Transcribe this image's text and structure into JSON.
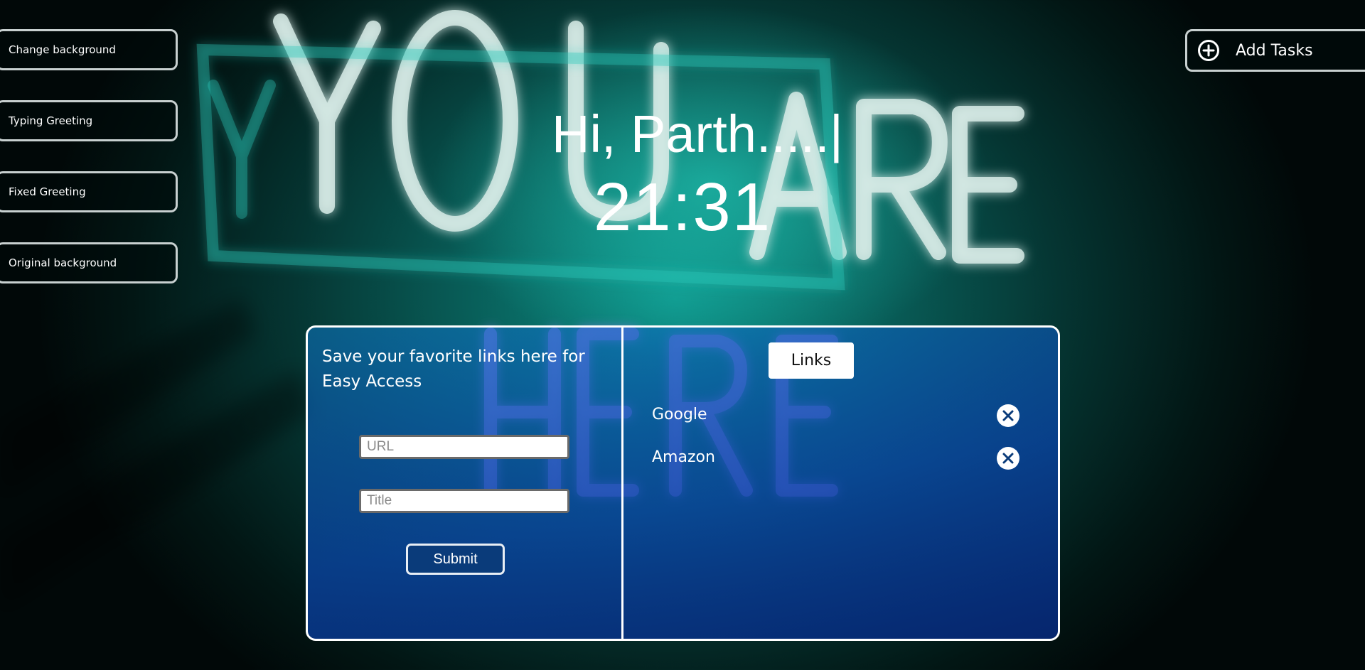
{
  "sidebar": {
    "buttons": [
      {
        "label": "Change background"
      },
      {
        "label": "Typing Greeting"
      },
      {
        "label": "Fixed Greeting"
      },
      {
        "label": "Original background"
      }
    ]
  },
  "tasks": {
    "add_label": "Add Tasks",
    "icon": "plus-circle-icon"
  },
  "greeting": {
    "text": "Hi, Parth.....|"
  },
  "clock": {
    "time": "21:31"
  },
  "background_art": {
    "lines": [
      "YOU ARE",
      "HERE"
    ],
    "accent": "#1fd6c3"
  },
  "links_card": {
    "intro": "Save your favorite links here for Easy Access",
    "url_placeholder": "URL",
    "title_placeholder": "Title",
    "submit_label": "Submit",
    "header_label": "Links",
    "items": [
      {
        "title": "Google",
        "remove_icon": "close-icon"
      },
      {
        "title": "Amazon",
        "remove_icon": "close-icon"
      }
    ]
  },
  "colors": {
    "card_border": "#ffffff",
    "card_fill": "#0a4aa8",
    "remove_icon": "#0a3b7a"
  }
}
